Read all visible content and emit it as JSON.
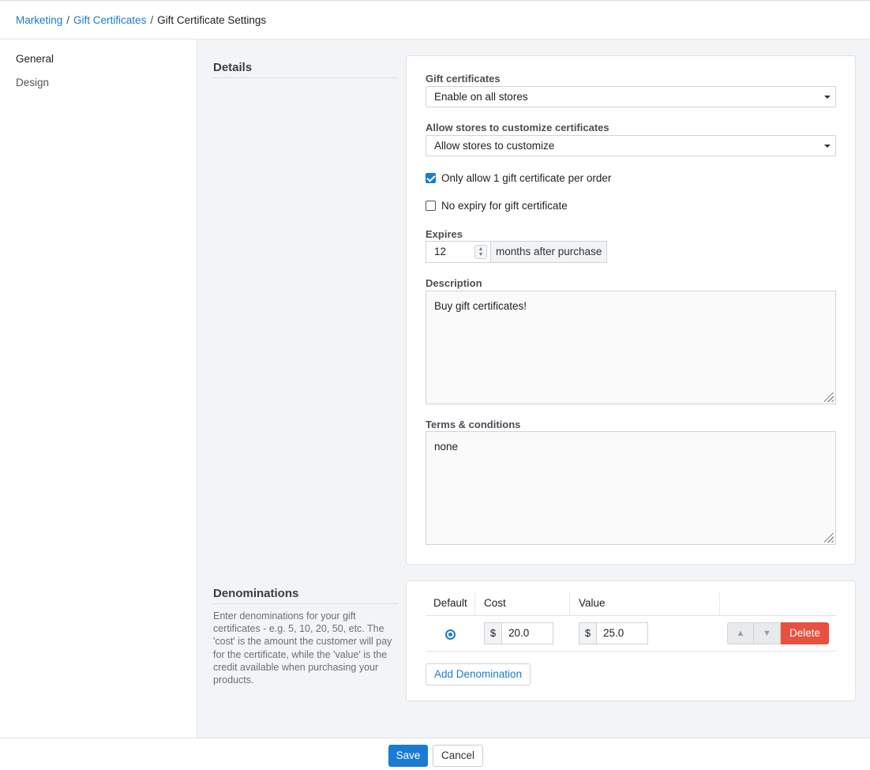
{
  "breadcrumb": {
    "items": [
      "Marketing",
      "Gift Certificates"
    ],
    "current": "Gift Certificate Settings",
    "separator": "/"
  },
  "sidebar": {
    "items": [
      {
        "label": "General",
        "active": true
      },
      {
        "label": "Design",
        "active": false
      }
    ]
  },
  "details": {
    "section_title": "Details",
    "gift_certificates": {
      "label": "Gift certificates",
      "value": "Enable on all stores"
    },
    "customize": {
      "label": "Allow stores to customize certificates",
      "value": "Allow stores to customize"
    },
    "only_one": {
      "label": "Only allow 1 gift certificate per order",
      "checked": true
    },
    "no_expiry": {
      "label": "No expiry for gift certificate",
      "checked": false
    },
    "expires": {
      "label": "Expires",
      "value": "12",
      "suffix": "months after purchase"
    },
    "description": {
      "label": "Description",
      "value": "Buy gift certificates!"
    },
    "terms": {
      "label": "Terms & conditions",
      "value": "none"
    }
  },
  "denominations": {
    "section_title": "Denominations",
    "help": "Enter denominations for your gift certificates - e.g. 5, 10, 20, 50, etc. The 'cost' is the amount the customer will pay for the certificate, while the 'value' is the credit available when purchasing your products.",
    "headers": {
      "default": "Default",
      "cost": "Cost",
      "value": "Value"
    },
    "rows": [
      {
        "default": true,
        "currency": "$",
        "cost": "20.0",
        "value": "25.0"
      }
    ],
    "up_arrow": "▲",
    "down_arrow": "▼",
    "delete_label": "Delete",
    "add_label": "Add Denomination"
  },
  "footer": {
    "save_label": "Save",
    "cancel_label": "Cancel"
  },
  "colors": {
    "accent": "#1a7bd3",
    "danger": "#e8503f"
  }
}
